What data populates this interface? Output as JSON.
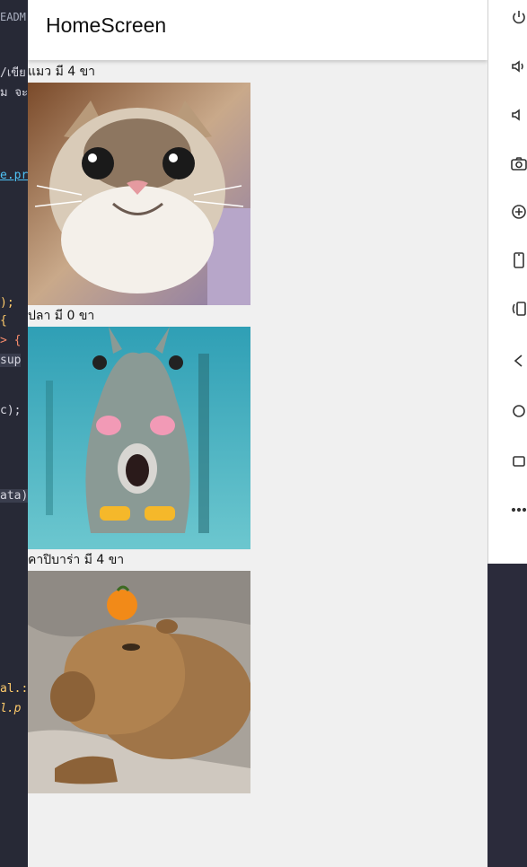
{
  "editor": {
    "tab_label": "EADM",
    "lines": [
      {
        "text": "/เขีย"
      },
      {
        "text": "ม จะ"
      },
      {
        "text": "e.pr"
      },
      {
        "text": ");"
      },
      {
        "text": "{"
      },
      {
        "text": "> {"
      },
      {
        "text": "sup"
      },
      {
        "text": "c);"
      },
      {
        "text": "ata)"
      },
      {
        "text": "al.:"
      },
      {
        "text": "l.p"
      }
    ]
  },
  "app": {
    "title": "HomeScreen"
  },
  "animals": [
    {
      "caption": "แมว มี 4 ขา",
      "image": "smiling-cat"
    },
    {
      "caption": "ปลา มี 0 ขา",
      "image": "fish-with-emoji"
    },
    {
      "caption": "คาปิบาร่า มี 4 ขา",
      "image": "capybara-with-orange"
    }
  ],
  "emulator_toolbar": {
    "icons": [
      "power-icon",
      "volume-up-icon",
      "volume-down-icon",
      "camera-icon",
      "zoom-in-icon",
      "phone-portrait-icon",
      "rotate-icon",
      "back-icon",
      "home-icon",
      "overview-icon",
      "more-icon"
    ]
  }
}
